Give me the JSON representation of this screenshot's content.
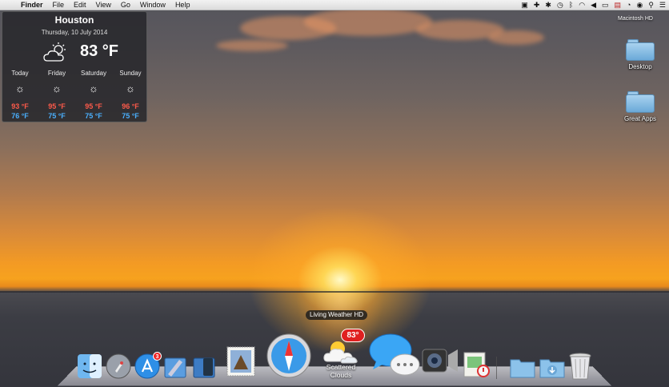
{
  "menubar": {
    "apple": "",
    "app_name": "Finder",
    "menus": [
      "File",
      "Edit",
      "View",
      "Go",
      "Window",
      "Help"
    ],
    "status_icons": [
      "dropbox-icon",
      "plus-icon",
      "gear-icon",
      "time-machine-icon",
      "bluetooth-icon",
      "wifi-icon",
      "volume-icon",
      "battery-icon",
      "flag-icon",
      "clock-icon",
      "user-icon",
      "spotlight-icon",
      "list-icon"
    ]
  },
  "weather_widget": {
    "city": "Houston",
    "date": "Thursday, 10 July 2014",
    "current_temp": "83 °F",
    "current_icon": "partly-cloudy-icon",
    "forecast": [
      {
        "day": "Today",
        "high": "93 °F",
        "low": "76 °F",
        "icon": "sun-icon"
      },
      {
        "day": "Friday",
        "high": "95 °F",
        "low": "75 °F",
        "icon": "sun-icon"
      },
      {
        "day": "Saturday",
        "high": "95 °F",
        "low": "75 °F",
        "icon": "sun-icon"
      },
      {
        "day": "Sunday",
        "high": "96 °F",
        "low": "75 °F",
        "icon": "sun-icon"
      }
    ],
    "colors": {
      "high": "#ff5a4a",
      "low": "#4ab0ff"
    }
  },
  "desktop": {
    "drive_label": "Macintosh HD",
    "icons": [
      {
        "label": "Desktop",
        "icon": "folder-icon"
      },
      {
        "label": "Great Apps",
        "icon": "folder-alias-icon"
      }
    ]
  },
  "dock": {
    "tooltip": "Living Weather HD",
    "app_store_badge": "3",
    "weather_badge": "83°",
    "weather_label_line1": "Scattered",
    "weather_label_line2": "Clouds",
    "items": [
      "finder-icon",
      "launchpad-icon",
      "app-store-icon",
      "xcode-icon",
      "xcode-dark-icon",
      "mail-icon",
      "safari-icon",
      "living-weather-icon",
      "messages-icon",
      "facetime-icon",
      "preview-icon",
      "applications-folder-icon",
      "downloads-folder-icon",
      "trash-icon"
    ]
  }
}
